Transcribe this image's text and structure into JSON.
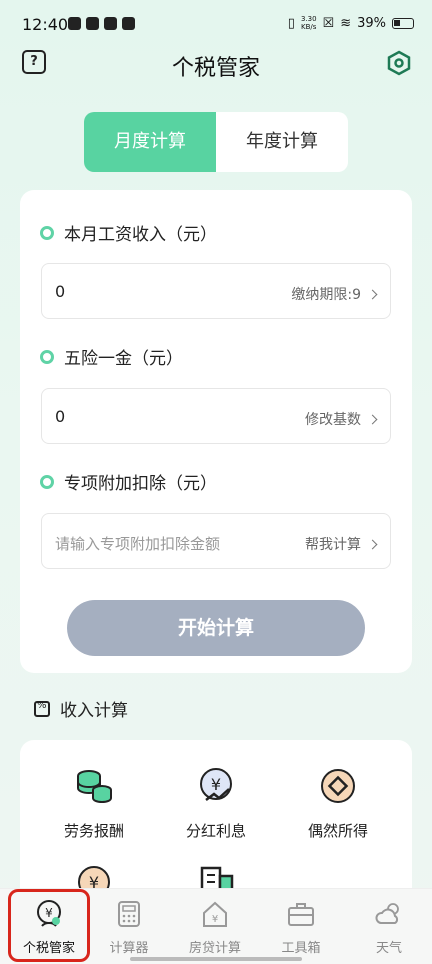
{
  "status_bar": {
    "time": "12:40",
    "net_speed_value": "3.30",
    "net_speed_unit": "KB/s",
    "battery": "39%"
  },
  "header": {
    "title": "个税管家",
    "help_icon": "question-mark-icon",
    "settings_icon": "hexagon-settings-icon"
  },
  "tabs": [
    {
      "label": "月度计算",
      "active": true
    },
    {
      "label": "年度计算",
      "active": false
    }
  ],
  "form": {
    "salary": {
      "label": "本月工资收入（元）",
      "value": "0",
      "action": "缴纳期限:9"
    },
    "insurance": {
      "label": "五险一金（元）",
      "value": "0",
      "action": "修改基数"
    },
    "special": {
      "label": "专项附加扣除（元）",
      "placeholder": "请输入专项附加扣除金额",
      "action": "帮我计算"
    },
    "start_button": "开始计算"
  },
  "income_section": {
    "title": "收入计算",
    "items": [
      {
        "label": "劳务报酬",
        "icon": "coin-stack-icon"
      },
      {
        "label": "分红利息",
        "icon": "yen-trend-icon"
      },
      {
        "label": "偶然所得",
        "icon": "diamond-coin-icon"
      },
      {
        "label": "",
        "icon": "yen-hand-icon"
      },
      {
        "label": "",
        "icon": "building-icon"
      }
    ]
  },
  "bottom_nav": [
    {
      "label": "个税管家",
      "icon": "yen-person-icon",
      "active": true
    },
    {
      "label": "计算器",
      "icon": "calculator-icon",
      "active": false
    },
    {
      "label": "房贷计算",
      "icon": "house-yen-icon",
      "active": false
    },
    {
      "label": "工具箱",
      "icon": "toolbox-icon",
      "active": false
    },
    {
      "label": "天气",
      "icon": "weather-icon",
      "active": false
    }
  ],
  "colors": {
    "accent": "#58d3a1",
    "button_disabled": "#a5afc0",
    "highlight": "#d8261c"
  }
}
